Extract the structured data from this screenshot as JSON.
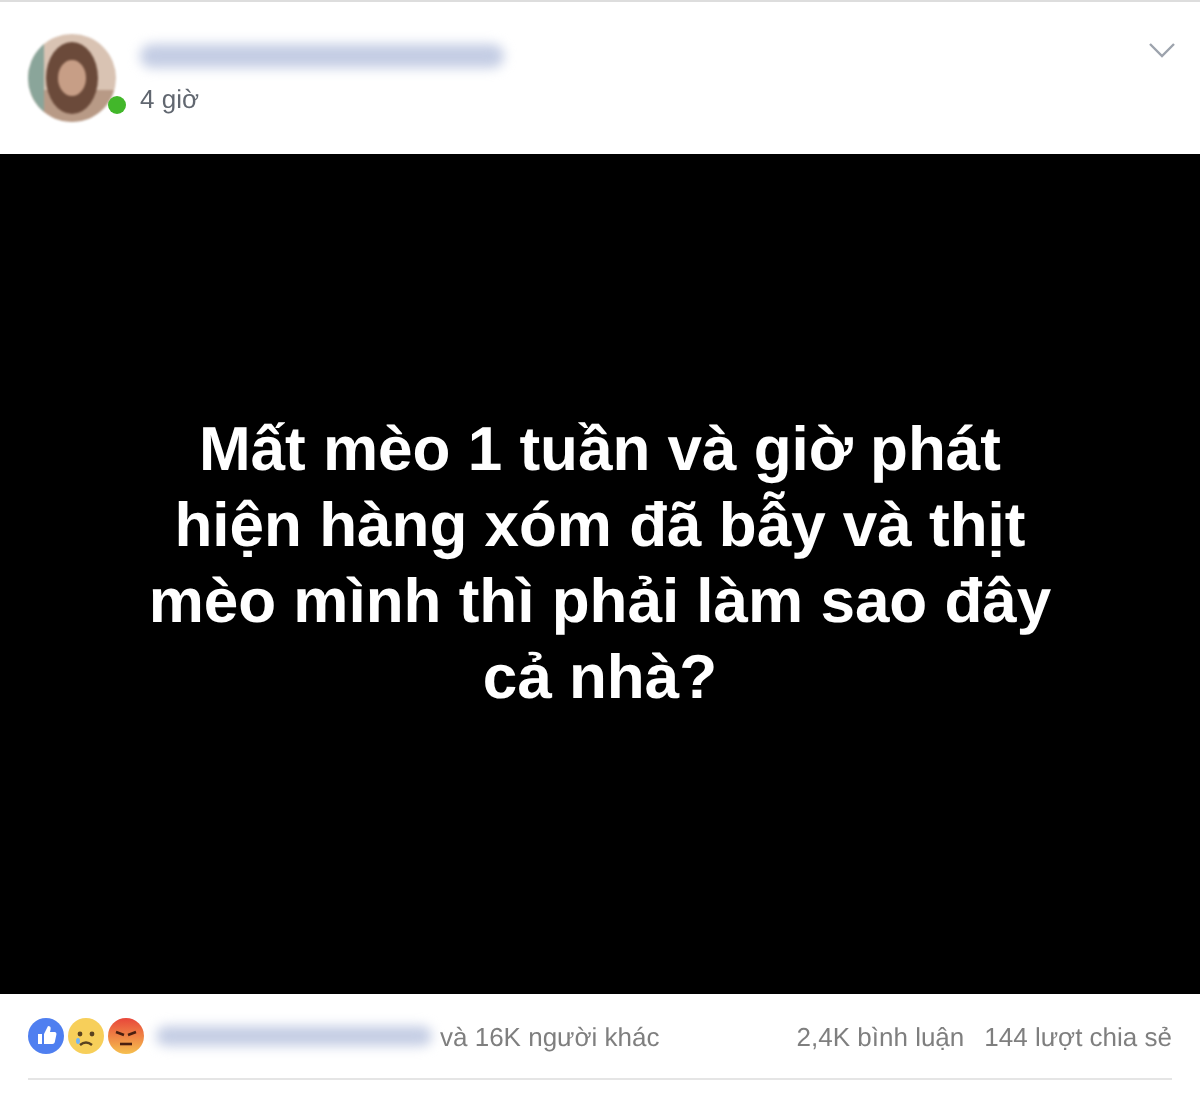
{
  "post": {
    "author_online": true,
    "time": "4 giờ",
    "content_lines": [
      "Mất mèo 1 tuần và giờ phát",
      "hiện hàng xóm đã bẫy và thịt",
      "mèo mình thì phải làm sao đây",
      "cả nhà?"
    ]
  },
  "footer": {
    "reactions": [
      {
        "kind": "like"
      },
      {
        "kind": "sad"
      },
      {
        "kind": "angry"
      }
    ],
    "others": "và 16K người khác",
    "comments": "2,4K bình luận",
    "shares": "144 lượt chia sẻ"
  }
}
